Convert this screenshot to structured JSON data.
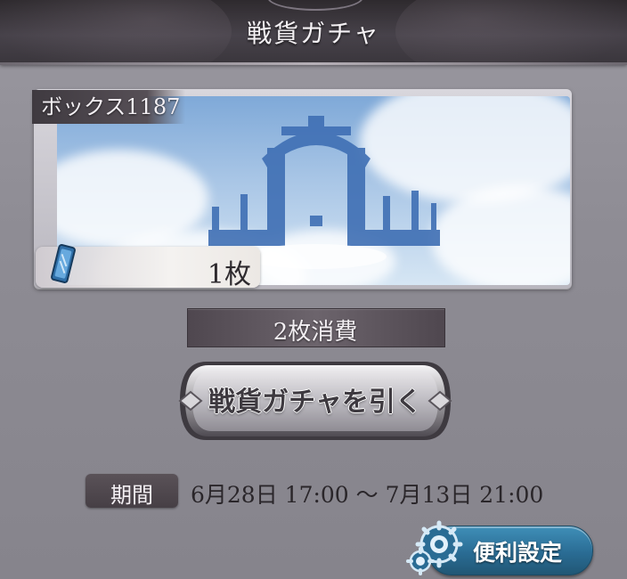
{
  "header": {
    "title": "戦貨ガチャ"
  },
  "box": {
    "label": "ボックス1187"
  },
  "ticket": {
    "count": "1枚"
  },
  "draw": {
    "cost_label": "2枚消費",
    "button_label": "戦貨ガチャを引く"
  },
  "period": {
    "label": "期間",
    "value": "6月28日 17:00 〜 7月13日 21:00"
  },
  "settings": {
    "label": "便利設定"
  },
  "colors": {
    "header": "#3a363c",
    "settings_button": "#2a6c94",
    "panel": "#8e8c94"
  },
  "icons": {
    "ticket": "ticket-icon",
    "gear": "gear-icon"
  }
}
